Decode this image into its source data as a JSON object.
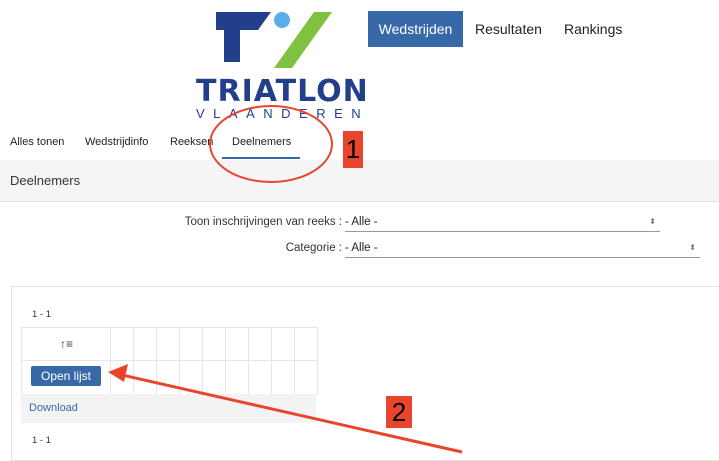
{
  "logo": {
    "main": "TRIATLON",
    "sub": "VLAANDEREN",
    "colors": {
      "blue": "#233e8b",
      "green": "#7fc241",
      "lightblue": "#5aaee6"
    }
  },
  "nav": {
    "items": [
      "Wedstrijden",
      "Resultaten",
      "Rankings"
    ],
    "active_color": "#3769a8"
  },
  "tabs": [
    "Alles tonen",
    "Wedstrijdinfo",
    "Reeksen",
    "Deelnemers"
  ],
  "panel": {
    "title": "Deelnemers",
    "filter_reeks_label": "Toon inschrijvingen van reeks :",
    "filter_reeks_value": "- Alle -",
    "filter_cat_label": "Categorie :",
    "filter_cat_value": "- Alle -"
  },
  "list": {
    "count_top": "1 - 1",
    "count_bottom": "1 - 1",
    "sort_icon": "↑≡",
    "open_button": "Open lijst",
    "download_link": "Download"
  },
  "annotations": {
    "one": "1",
    "two": "2",
    "color": "#e8452c"
  }
}
